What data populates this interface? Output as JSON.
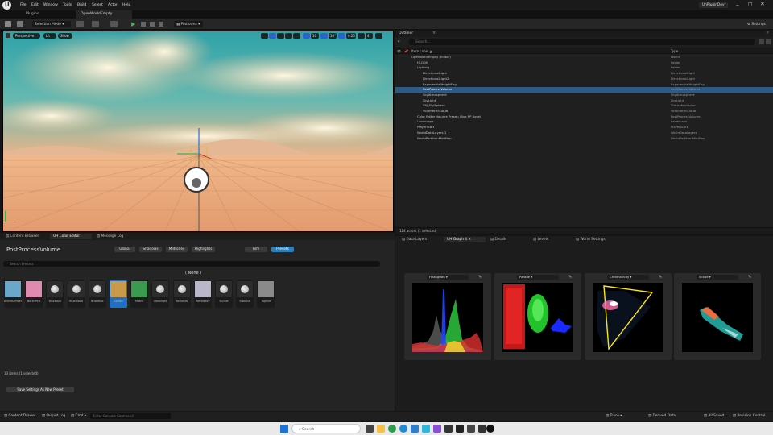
{
  "menubar": {
    "items": [
      "File",
      "Edit",
      "Window",
      "Tools",
      "Build",
      "Select",
      "Actor",
      "Help"
    ],
    "project": "UhPluginDev"
  },
  "tabs": [
    {
      "label": "Plugins"
    },
    {
      "label": "OpenWorldEmpty"
    }
  ],
  "toolbar": {
    "mode": "Selection Mode",
    "platforms": "Platforms",
    "settings": "Settings"
  },
  "viewport": {
    "perspective": "Perspective",
    "lit": "Lit",
    "show": "Show",
    "snap1": "10",
    "snap2": "10°",
    "snap3": "0.25",
    "snap4": "4"
  },
  "outliner": {
    "tab": "Outliner",
    "search_placeholder": "Search...",
    "col_label": "Item Label ▲",
    "col_type": "Type",
    "rows": [
      {
        "name": "OpenWorldEmpty (Editor)",
        "type": "World",
        "indent": 0
      },
      {
        "name": "HLOD0",
        "type": "Folder",
        "indent": 1
      },
      {
        "name": "Lighting",
        "type": "Folder",
        "indent": 1
      },
      {
        "name": "DirectionalLight",
        "type": "DirectionalLight",
        "indent": 2
      },
      {
        "name": "DirectionalLight2",
        "type": "DirectionalLight",
        "indent": 2
      },
      {
        "name": "ExponentialHeightFog",
        "type": "ExponentialHeightFog",
        "indent": 2
      },
      {
        "name": "PostProcessVolume",
        "type": "PostProcessVolume",
        "indent": 2,
        "selected": true
      },
      {
        "name": "SkyAtmosphere",
        "type": "SkyAtmosphere",
        "indent": 2
      },
      {
        "name": "SkyLight",
        "type": "SkyLight",
        "indent": 2
      },
      {
        "name": "SM_SkySphere",
        "type": "StaticMeshActor",
        "indent": 2
      },
      {
        "name": "VolumetricCloud",
        "type": "VolumetricCloud",
        "indent": 2
      },
      {
        "name": "Color Editor Volume Preset: Blue PP Asset",
        "type": "PostProcessVolume",
        "indent": 1
      },
      {
        "name": "Landscape",
        "type": "Landscape",
        "indent": 1
      },
      {
        "name": "PlayerStart",
        "type": "PlayerStart",
        "indent": 1
      },
      {
        "name": "WorldDataLayers-1",
        "type": "WorldDataLayers",
        "indent": 1
      },
      {
        "name": "WorldPartitionMiniMap",
        "type": "WorldPartitionMiniMap",
        "indent": 1
      }
    ],
    "footer": "124 actors (1 selected)"
  },
  "bottom_tabs": [
    "Content Browser",
    "UH Color Editor",
    "Message Log"
  ],
  "color_editor": {
    "volume_name": "PostProcessVolume",
    "segments": [
      "Global",
      "Shadows",
      "Midtones",
      "Highlights"
    ],
    "modes": [
      "Film",
      "Presets"
    ],
    "search_placeholder": "Search Presets",
    "current": "( None )",
    "presets": [
      {
        "label": "AnimeLimiter",
        "color": "#6aa7c9"
      },
      {
        "label": "BerlinPink",
        "color": "#e08ab0"
      },
      {
        "label": "BlackJack",
        "color": "knob"
      },
      {
        "label": "BlueBlood",
        "color": "knob"
      },
      {
        "label": "BriskBlue",
        "color": "knob"
      },
      {
        "label": "Golden",
        "color": "#c89a4a",
        "selected": true
      },
      {
        "label": "Matrix",
        "color": "#3a9a50"
      },
      {
        "label": "Neonlight",
        "color": "knob"
      },
      {
        "label": "Redlands",
        "color": "knob"
      },
      {
        "label": "Retrowave",
        "color": "#b9b6ca"
      },
      {
        "label": "Sunset",
        "color": "knob"
      },
      {
        "label": "Swedish",
        "color": "knob"
      },
      {
        "label": "Topline",
        "color": "#8a8a8a"
      }
    ],
    "footer": "13 items (1 selected)",
    "save_button": "Save Settings As New Preset"
  },
  "right_tabs": [
    "Data Layers",
    "UH Graph 4",
    "Details",
    "Levels",
    "World Settings"
  ],
  "scopes": [
    {
      "label": "Histogram"
    },
    {
      "label": "Parade"
    },
    {
      "label": "Chromaticity"
    },
    {
      "label": "Scope"
    }
  ],
  "statusbar": {
    "content_drawer": "Content Drawer",
    "output_log": "Output Log",
    "cmd": "Cmd",
    "cmd_placeholder": "Enter Console Command",
    "trace": "Trace",
    "derived": "Derived Data",
    "saved": "All Saved",
    "revision": "Revision Control"
  },
  "taskbar": {
    "search": "Search"
  }
}
